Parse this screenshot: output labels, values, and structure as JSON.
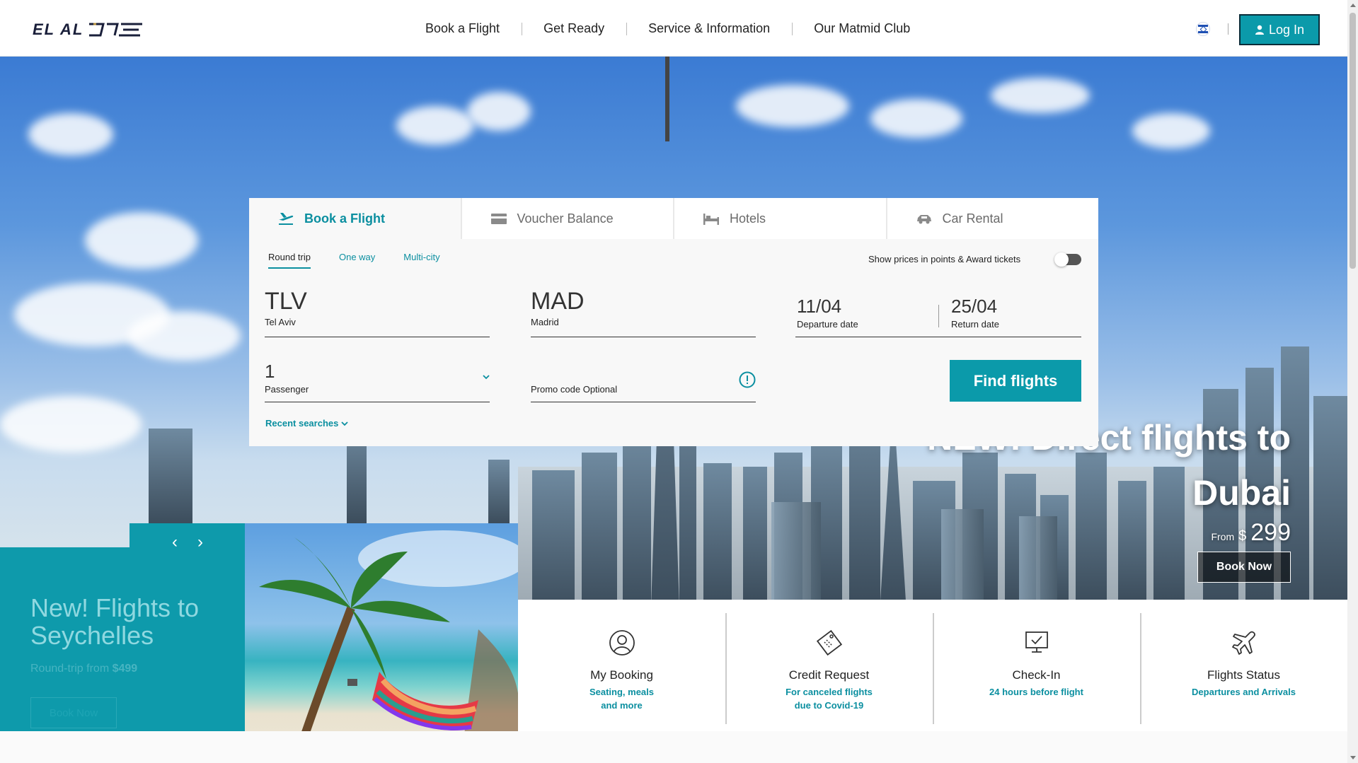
{
  "header": {
    "logo_text": "EL AL",
    "nav": [
      "Book a Flight",
      "Get Ready",
      "Service & Information",
      "Our Matmid Club"
    ],
    "login_label": "Log In"
  },
  "booking": {
    "tabs": [
      "Book a Flight",
      "Voucher Balance",
      "Hotels",
      "Car Rental"
    ],
    "trip_types": [
      "Round trip",
      "One way",
      "Multi-city"
    ],
    "award_label": "Show prices in points & Award tickets",
    "origin": {
      "code": "TLV",
      "city": "Tel Aviv"
    },
    "destination": {
      "code": "MAD",
      "city": "Madrid"
    },
    "departure": {
      "date": "11/04",
      "label": "Departure date"
    },
    "return": {
      "date": "25/04",
      "label": "Return date"
    },
    "passengers": {
      "count": "1",
      "label": "Passenger"
    },
    "promo_placeholder": "Promo code Optional",
    "find_label": "Find flights",
    "recent_label": "Recent searches"
  },
  "promo_main": {
    "title_line1": "NEW! Direct flights to",
    "title_line2": "Dubai",
    "from_label": "From",
    "currency": "$",
    "price": "299",
    "cta": "Book Now"
  },
  "promo_side": {
    "title": "New! Flights to Seychelles",
    "sub_prefix": "Round-trip from ",
    "price": "$499",
    "cta": "Book Now"
  },
  "slider": {
    "prev": "‹",
    "next": "›"
  },
  "quick_links": [
    {
      "title": "My Booking",
      "sub": "Seating, meals and more",
      "icon": "user-circle-icon"
    },
    {
      "title": "Credit Request",
      "sub": "For canceled flights due to Covid-19",
      "icon": "ticket-icon"
    },
    {
      "title": "Check-In",
      "sub": "24 hours before flight",
      "icon": "monitor-check-icon"
    },
    {
      "title": "Flights Status",
      "sub": "Departures and Arrivals",
      "icon": "plane-icon"
    }
  ],
  "colors": {
    "accent": "#0b9aaa",
    "link": "#0b8fa0",
    "header_bg": "#ffffff"
  }
}
